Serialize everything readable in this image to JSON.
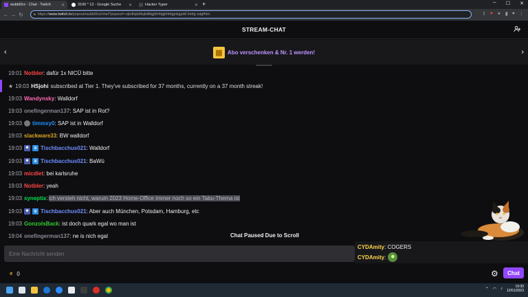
{
  "browser": {
    "tabs": [
      {
        "title": "wubbl0rz - Chat - Twitch",
        "fav_color": "#9147ff",
        "active": true
      },
      {
        "title": "3100 * 12 - Google Suche",
        "fav_color": "#ffffff",
        "active": false
      },
      {
        "title": "Hacker Typer",
        "fav_color": "#222222",
        "active": false
      }
    ],
    "new_tab": "+",
    "url_prefix": "https://",
    "url_host": "www.twitch.tv",
    "url_rest": "/popout/wubbl0rz/chat?popout=-njkdfsjkdfsjkdfdgjkhfdgjkhfdgjnkjgsfd kmfg sdgfhkn"
  },
  "chat": {
    "header_title": "STREAM-CHAT",
    "gift_banner": "Abo verschenken & Nr. 1 werden!",
    "gift_icon": "gift-icon",
    "messages": [
      {
        "time": "19:01",
        "user": "Notbler",
        "color": "#ff4545",
        "text": ": dafür 1x NICÜ bitte",
        "badges": []
      },
      {
        "time": "19:03",
        "user": "Wandynsky",
        "color": "#ff69b4",
        "text": ": Walldorf",
        "badges": []
      },
      {
        "time": "19:03",
        "user": "onefingerman137",
        "color": "#8a8a95",
        "text": ": SAP ist in Rot?",
        "badges": []
      },
      {
        "time": "19:03",
        "user": "timmxy0",
        "color": "#1e90ff",
        "text": ": SAP ist in Walldorf",
        "badges": [
          "avatar"
        ]
      },
      {
        "time": "19:03",
        "user": "slackware33",
        "color": "#daa520",
        "text": ": BW walldorf",
        "badges": []
      },
      {
        "time": "19:03",
        "user": "Tischbacchus021",
        "color": "#6e8fff",
        "text": ": Walldorf",
        "badges": [
          "sub",
          "bit"
        ]
      },
      {
        "time": "19:03",
        "user": "Tischbacchus021",
        "color": "#6e8fff",
        "text": ": BaWü",
        "badges": [
          "sub",
          "bit"
        ]
      },
      {
        "time": "19:03",
        "user": "micdiet",
        "color": "#ff4545",
        "text": ": bei karlsruhe",
        "badges": []
      },
      {
        "time": "19:03",
        "user": "Notbler",
        "color": "#ff4545",
        "text": ": yeah",
        "badges": []
      },
      {
        "time": "19:03",
        "user": "syneptix",
        "color": "#00e050",
        "text": "ich versteh nicht, warum 2023 Home-Office immer noch so ein Tabu-Thema ist",
        "badges": [],
        "selected": true
      },
      {
        "time": "19:03",
        "user": "Tischbacchus021",
        "color": "#6e8fff",
        "text": ": Aber auch München, Potsdam, Hamburg, etc",
        "badges": [
          "sub",
          "bit"
        ]
      },
      {
        "time": "19:03",
        "user": "GonzolsBack",
        "color": "#32cd32",
        "text": ": ist doch quark egal wo man ist",
        "badges": []
      },
      {
        "time": "19:04",
        "user": "onefingerman137",
        "color": "#8a8a95",
        "text": ": ne is nich egal",
        "badges": []
      }
    ],
    "sub_notice": {
      "time": "19:03",
      "user": "HSjohi",
      "text": "subscribed at Tier 1. They've subscribed for 37 months, currently on a 37 month streak!"
    },
    "paused_label": "Chat Paused Due to Scroll",
    "input_placeholder": "Eine Nachricht senden",
    "points": "0",
    "send_label": "Chat"
  },
  "overlay": {
    "lines": [
      {
        "user": "CYDAmity",
        "text": ": COGERS"
      },
      {
        "user": "CYDAmity",
        "text": ":"
      }
    ]
  },
  "taskbar": {
    "time": "19:30",
    "date": "12/01/2023"
  }
}
